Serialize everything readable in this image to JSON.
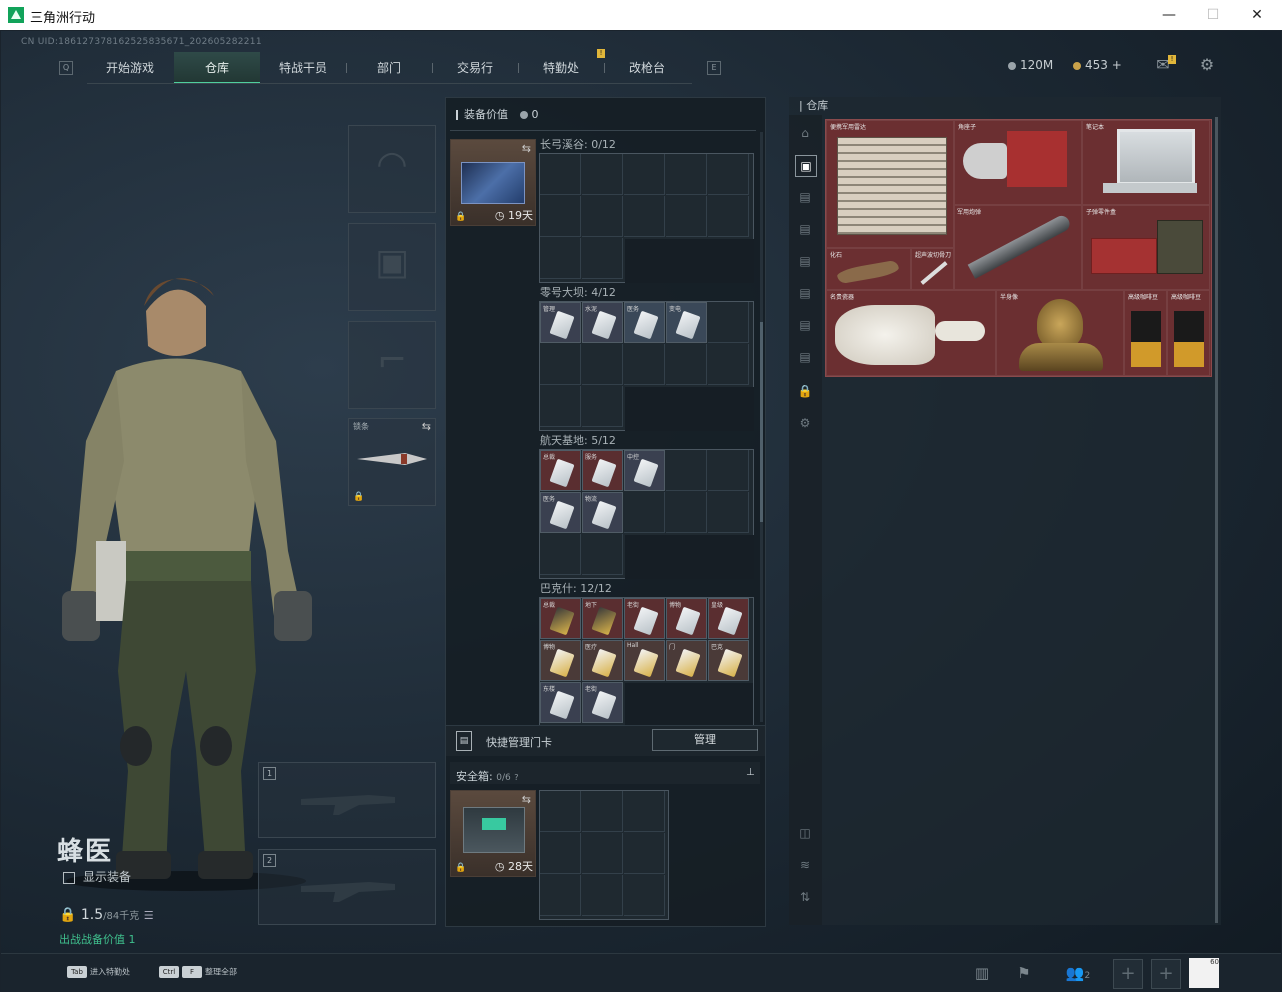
{
  "window": {
    "title": "三角洲行动",
    "minimize": "—",
    "maximize": "☐",
    "close": "✕"
  },
  "cnuid": "CN UID:18612737816252583567​1_202605282211",
  "nav": {
    "left_key": "Q",
    "right_key": "E",
    "tabs": [
      {
        "label": "开始游戏"
      },
      {
        "label": "仓库",
        "active": true
      },
      {
        "label": "特战干员"
      },
      {
        "label": "部门"
      },
      {
        "label": "交易行"
      },
      {
        "label": "特勤处",
        "badge": "!"
      },
      {
        "label": "改枪台"
      }
    ]
  },
  "currency": {
    "coins": "120M",
    "tickets": "453 +",
    "mail_badge": "!"
  },
  "operator": {
    "name": "蜂医",
    "show_equipment": "显示装备",
    "weight": "1.5",
    "weight_max": "/84千克",
    "dungeon": "出战战备价值 1"
  },
  "equipment_slots": {
    "melee_label": "锁条",
    "weapon1": "1",
    "weapon2": "2"
  },
  "mid": {
    "equip_value_label": "装备价值",
    "equip_value": "0",
    "keycard_days": "19天",
    "groups": [
      {
        "title": "长弓溪谷: 0/12"
      },
      {
        "title": "零号大坝: 4/12"
      },
      {
        "title": "航天基地: 5/12"
      },
      {
        "title": "巴克什: 12/12"
      }
    ],
    "card_labels_dam": [
      "管理",
      "水泥",
      "医务",
      "变电"
    ],
    "card_labels_space": [
      "总裁",
      "服务",
      "中控",
      "医务",
      "物流"
    ],
    "card_labels_baksh": [
      "总裁",
      "地下",
      "老街",
      "博物",
      "皇级",
      "博物",
      "医疗",
      "Hall",
      "门",
      "巴克",
      "东楼",
      "老街"
    ],
    "quick_manage": "快捷管理门卡",
    "manage_btn": "管理",
    "safebox_label": "安全箱:",
    "safebox_count": "0/6",
    "safebox_days": "28天"
  },
  "stash": {
    "title": "仓库",
    "items": [
      {
        "label": "便携军用雷达"
      },
      {
        "label": "角座子"
      },
      {
        "label": "笔记本"
      },
      {
        "label": "军用炮弹"
      },
      {
        "label": "子弹零件盒"
      },
      {
        "label": "化石"
      },
      {
        "label": "超声波切骨刀"
      },
      {
        "label": "名贵瓷器"
      },
      {
        "label": "半身像"
      },
      {
        "label": "高级咖啡豆"
      },
      {
        "label": "高级咖啡豆"
      }
    ]
  },
  "bottom": {
    "hint1_key": "Tab",
    "hint1": "进入特勤处",
    "hint2_key1": "Ctrl",
    "hint2_key2": "F",
    "hint2": "整理全部",
    "squad_count": "2",
    "avatar_level": "60"
  },
  "colors": {
    "accent": "#4fcf9e",
    "stash_bg": "#6b2f31",
    "badge": "#e0b63a"
  }
}
